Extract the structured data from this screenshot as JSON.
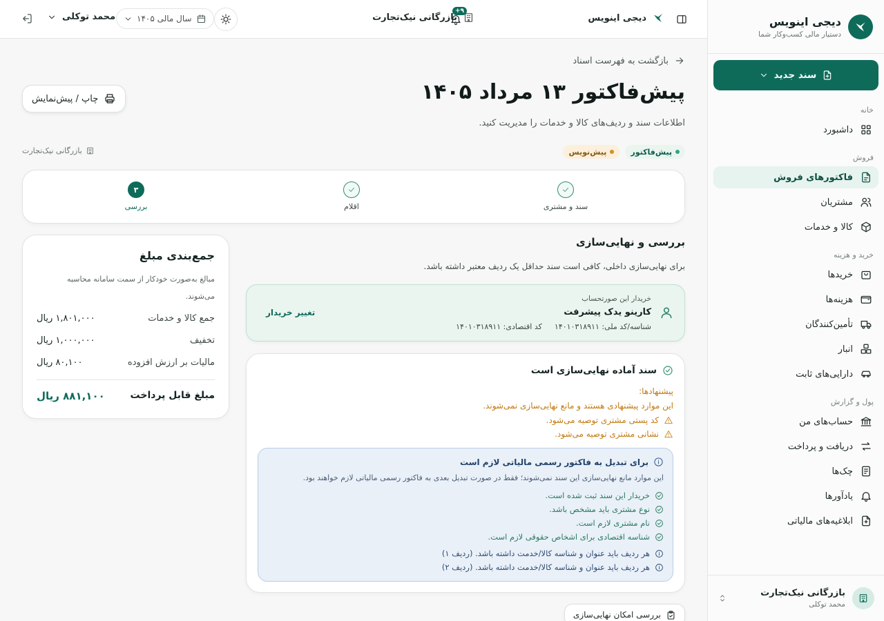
{
  "brand": {
    "title": "دیجی اینویس",
    "subtitle": "دستیار مالی کسب‌وکار شما"
  },
  "sidebar": {
    "new_doc_label": "سند جدید",
    "groups": [
      {
        "label": "خانه",
        "items": [
          {
            "label": "داشبورد",
            "icon": "dashboard-icon"
          }
        ]
      },
      {
        "label": "فروش",
        "items": [
          {
            "label": "فاکتورهای فروش",
            "icon": "invoice-icon",
            "active": true
          },
          {
            "label": "مشتریان",
            "icon": "users-icon"
          },
          {
            "label": "کالا و خدمات",
            "icon": "box-icon"
          }
        ]
      },
      {
        "label": "خرید و هزینه",
        "items": [
          {
            "label": "خریدها",
            "icon": "bag-icon"
          },
          {
            "label": "هزینه‌ها",
            "icon": "wallet-icon"
          },
          {
            "label": "تأمین‌کنندگان",
            "icon": "truck-icon"
          },
          {
            "label": "انبار",
            "icon": "warehouse-icon"
          },
          {
            "label": "دارایی‌های ثابت",
            "icon": "car-icon"
          }
        ]
      },
      {
        "label": "پول و گزارش",
        "items": [
          {
            "label": "حساب‌های من",
            "icon": "bank-icon"
          },
          {
            "label": "دریافت و پرداخت",
            "icon": "transfer-icon"
          },
          {
            "label": "چک‌ها",
            "icon": "cheque-icon"
          },
          {
            "label": "یادآورها",
            "icon": "bell-icon"
          },
          {
            "label": "ابلاغیه‌های مالیاتی",
            "icon": "tax-notice-icon"
          }
        ]
      }
    ],
    "footer": {
      "org": "بازرگانی نیک‌تجارت",
      "user": "محمد توکلی"
    }
  },
  "topbar": {
    "brand": "دیجی اینویس",
    "org": "بازرگانی نیک‌تجارت",
    "notifications": "۹+",
    "fiscal_year": "سال مالی ۱۴۰۵",
    "user": "محمد توکلی"
  },
  "page": {
    "back_label": "بازگشت به فهرست اسناد",
    "title": "پیش‌فاکتور ۱۳ مرداد ۱۴۰۵",
    "description": "اطلاعات سند و ردیف‌های کالا و خدمات را مدیریت کنید.",
    "print_label": "چاپ / پیش‌نمایش",
    "badge_type": "پیش‌فاکتور",
    "badge_status": "پیش‌نویس",
    "org": "بازرگانی نیک‌تجارت"
  },
  "stepper": {
    "steps": [
      {
        "label": "سند و مشتری",
        "state": "done"
      },
      {
        "label": "اقلام",
        "state": "done"
      },
      {
        "label": "بررسی",
        "state": "current",
        "number": "۳"
      }
    ]
  },
  "review": {
    "title": "بررسی و نهایی‌سازی",
    "description": "برای نهایی‌سازی داخلی، کافی است سند حداقل یک ردیف معتبر داشته باشد.",
    "buyer": {
      "caption": "خریدار این صورتحساب",
      "name": "کارینو یدک پیشرفت",
      "national_id": "شناسه/کد ملی: ۱۴۰۱۰۳۱۸۹۱۱",
      "economic_code": "کد اقتصادی: ۱۴۰۱۰۳۱۸۹۱۱",
      "change_label": "تغییر خریدار"
    },
    "ready": {
      "title": "سند آماده نهایی‌سازی است",
      "suggestions_title": "پیشنهادها:",
      "suggestions_sub": "این موارد پیشنهادی هستند و مانع نهایی‌سازی نمی‌شوند.",
      "suggestions": [
        "کد پستی مشتری توصیه می‌شود.",
        "نشانی مشتری توصیه می‌شود."
      ],
      "tax": {
        "title": "برای تبدیل به فاکتور رسمی مالیاتی لازم است",
        "description": "این موارد مانع نهایی‌سازی این سند نمی‌شوند؛ فقط در صورت تبدیل بعدی به فاکتور رسمی مالیاتی لازم خواهند بود.",
        "checks": [
          "خریدار این سند ثبت شده است.",
          "نوع مشتری باید مشخص باشد.",
          "نام مشتری لازم است.",
          "شناسه اقتصادی برای اشخاص حقوقی لازم است."
        ],
        "notes": [
          "هر ردیف باید عنوان و شناسه کالا/خدمت داشته باشد. (ردیف ۱)",
          "هر ردیف باید عنوان و شناسه کالا/خدمت داشته باشد. (ردیف ۲)"
        ]
      }
    },
    "check_button": "بررسی امکان نهایی‌سازی"
  },
  "summary": {
    "title": "جمع‌بندی مبلغ",
    "description": "مبالغ به‌صورت خودکار از سمت سامانه محاسبه می‌شوند.",
    "rows": [
      {
        "label": "جمع کالا و خدمات",
        "value": "۱,۸۰۱,۰۰۰ ریال"
      },
      {
        "label": "تخفیف",
        "value": "۱,۰۰۰,۰۰۰ ریال"
      },
      {
        "label": "مالیات بر ارزش افزوده",
        "value": "۸۰,۱۰۰ ریال"
      }
    ],
    "total_label": "مبلغ قابل پرداخت",
    "total_value": "۸۸۱,۱۰۰ ریال"
  },
  "colors": {
    "brand": "#0e6b5a",
    "warning": "#c27a12",
    "info_bg": "#e9f0f8"
  }
}
